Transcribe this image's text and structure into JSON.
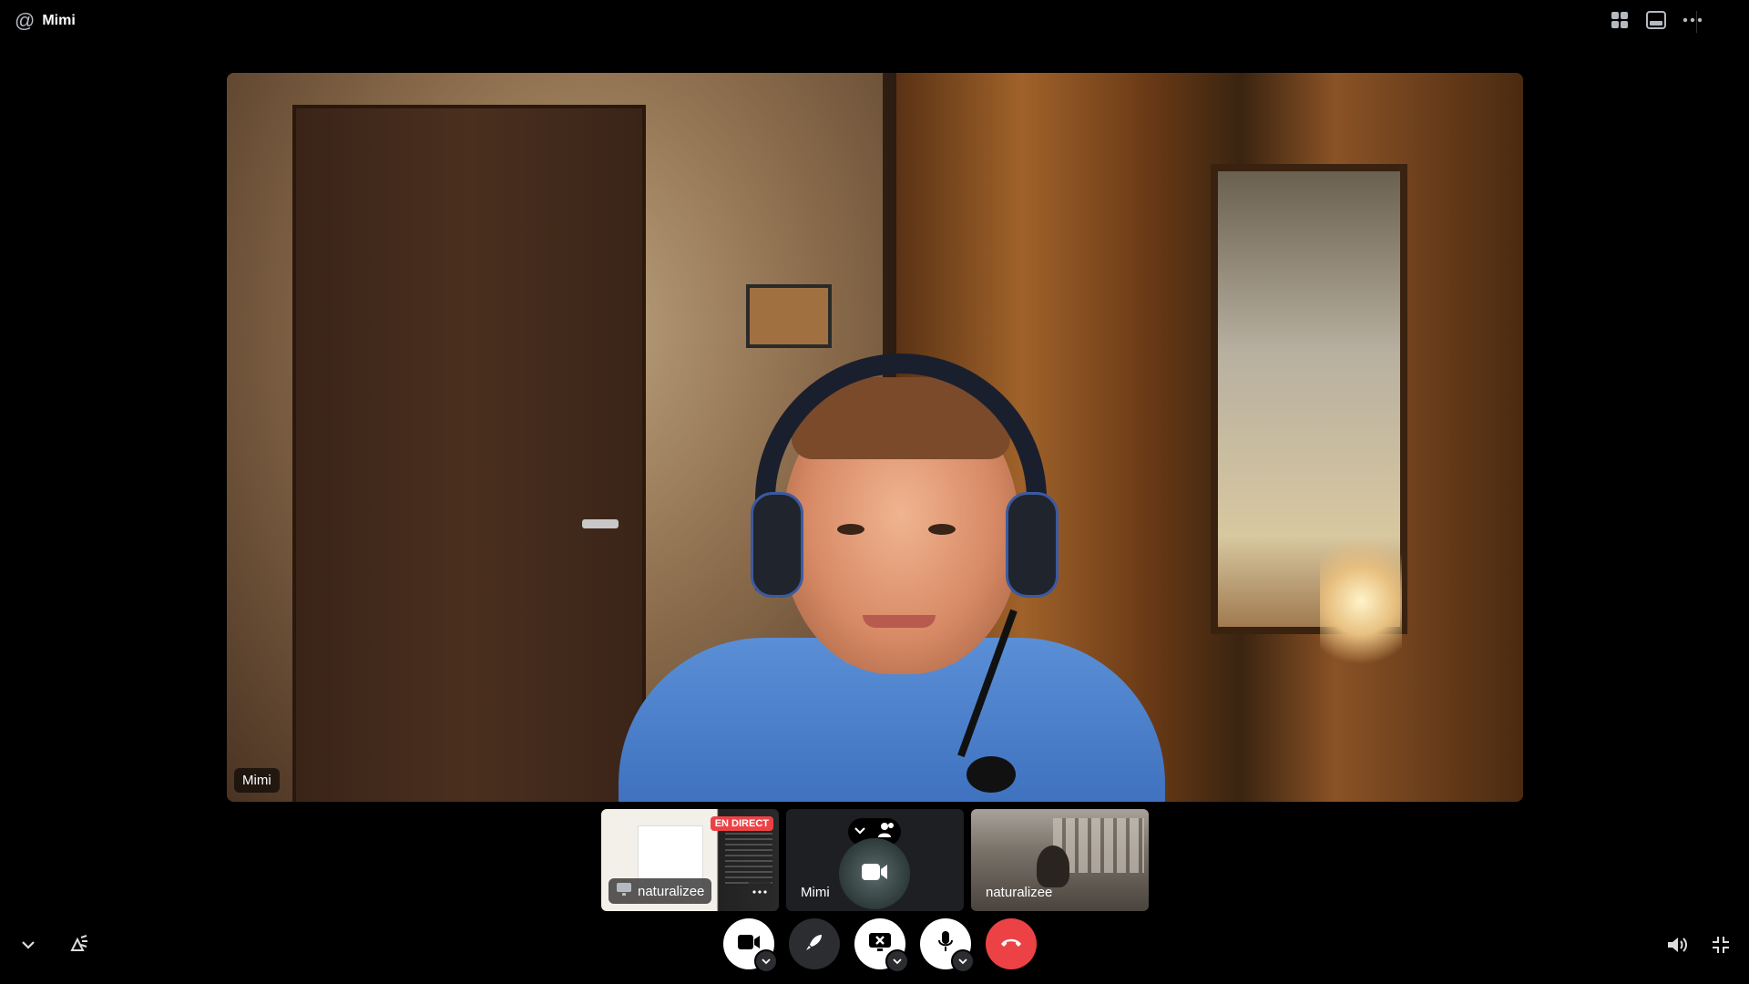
{
  "header": {
    "channel_prefix": "@",
    "channel_name": "Mimi",
    "actions": [
      {
        "name": "grid-icon"
      },
      {
        "name": "popout-icon"
      },
      {
        "name": "more-icon"
      }
    ]
  },
  "main_stage": {
    "participant_name": "Mimi"
  },
  "thumbnails": [
    {
      "type": "screen-share",
      "user": "naturalizee",
      "badge": "EN DIRECT"
    },
    {
      "type": "camera-off",
      "user": "Mimi"
    },
    {
      "type": "camera",
      "user": "naturalizee"
    }
  ],
  "controls": [
    {
      "name": "camera-button",
      "icon": "video-camera-icon",
      "has_menu": true
    },
    {
      "name": "activity-button",
      "icon": "rocket-icon",
      "has_menu": false
    },
    {
      "name": "screen-share-button",
      "icon": "screen-share-stop-icon",
      "has_menu": true
    },
    {
      "name": "mic-button",
      "icon": "microphone-icon",
      "has_menu": true
    },
    {
      "name": "disconnect-button",
      "icon": "hang-up-icon",
      "has_menu": false
    }
  ],
  "colors": {
    "background": "#000000",
    "danger": "#ed4245",
    "live_badge": "#ed4245",
    "control_dark": "#2b2d31"
  }
}
